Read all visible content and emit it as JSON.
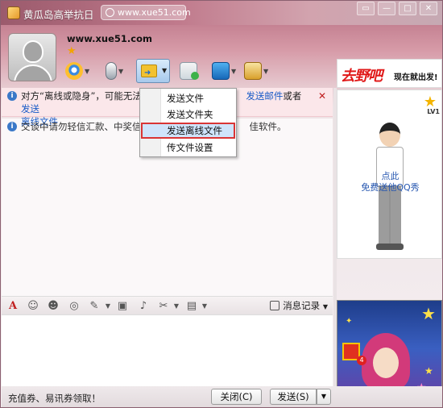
{
  "window": {
    "title": "黄瓜岛高举抗日",
    "url": "www.xue51.com"
  },
  "contact": {
    "name": "www.xue51.com"
  },
  "notice": {
    "text_before": "对方“离线或隐身”，可能无法立",
    "link1": "发送邮件",
    "middle": "或者",
    "link2": "发送离线文件",
    "link2_part1": "发送",
    "link2_part2": "离线文件"
  },
  "notice2": {
    "text_before": "交谈中请勿轻信汇款、中奖信",
    "text_after": "佳软件。"
  },
  "menu": {
    "items": [
      {
        "label": "发送文件"
      },
      {
        "label": "发送文件夹"
      },
      {
        "label": "发送离线文件"
      },
      {
        "label": "传文件设置"
      }
    ],
    "selected_index": 2
  },
  "input_toolbar": {
    "history_label": "消息记录"
  },
  "footer": {
    "promo_text": "充值券、易讯券领取！",
    "close_label": "关闭(C)",
    "send_label": "发送(S)"
  },
  "ads": {
    "top_big": "去野吧",
    "top_small": "现在就出发!",
    "show_line1": "点此",
    "show_line2": "免费送他QQ秀",
    "level": "LV1",
    "gift_count": "4"
  },
  "icons": {
    "app": "qq-penguin-icon",
    "globe": "globe-icon",
    "webcam": "webcam-icon",
    "mic": "microphone-icon",
    "send_file": "send-file-icon",
    "message": "message-icon",
    "remote": "remote-desktop-icon",
    "apps": "apps-icon"
  },
  "colors": {
    "link": "#1a5bc7",
    "menu_highlight": "#cfe4fb",
    "menu_border": "#d93535",
    "ad_red": "#e01818"
  }
}
